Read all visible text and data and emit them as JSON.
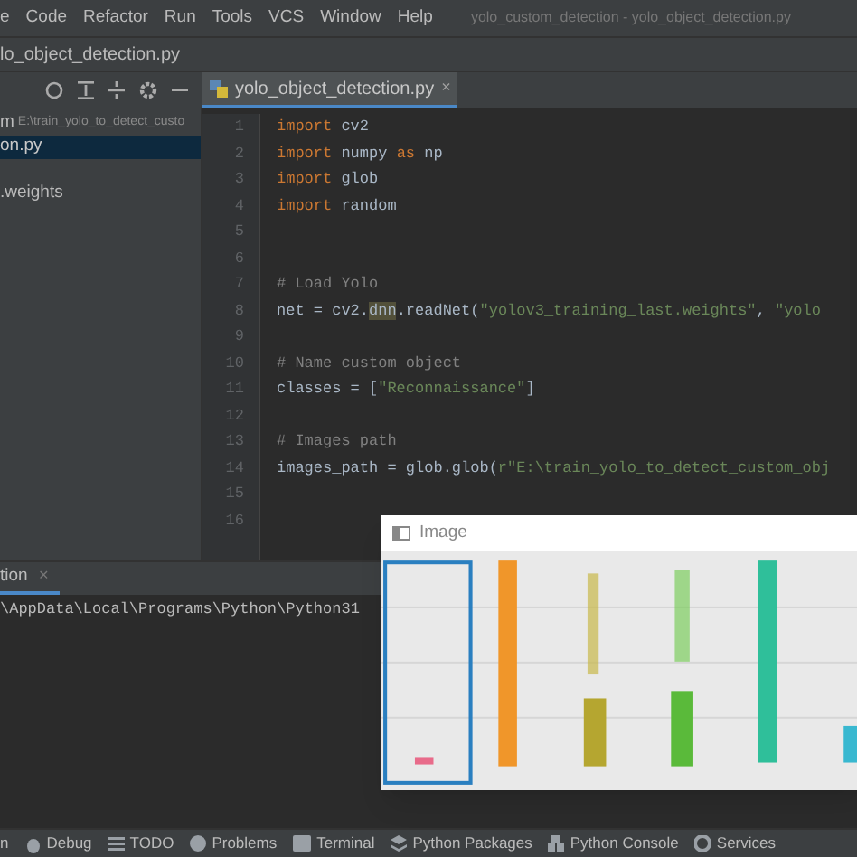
{
  "menu_bar": {
    "items": [
      "e",
      "Code",
      "Refactor",
      "Run",
      "Tools",
      "VCS",
      "Window",
      "Help"
    ],
    "title": "yolo_custom_detection - yolo_object_detection.py"
  },
  "breadcrumb": "lo_object_detection.py",
  "editor_tab": {
    "label": "yolo_object_detection.py",
    "close": "×"
  },
  "project_panel": [
    {
      "label": "m",
      "path": "E:\\train_yolo_to_detect_custo",
      "selected": false
    },
    {
      "label": "on.py",
      "selected": true
    },
    {
      "label": ".weights",
      "selected": false
    }
  ],
  "code_lines": [
    {
      "number": "1",
      "tokens": [
        {
          "kind": "keyword",
          "text": "import"
        },
        {
          "kind": "plain",
          "text": " cv2"
        }
      ]
    },
    {
      "number": "2",
      "tokens": [
        {
          "kind": "keyword",
          "text": "import"
        },
        {
          "kind": "plain",
          "text": " numpy "
        },
        {
          "kind": "keyword",
          "text": "as"
        },
        {
          "kind": "plain",
          "text": " np"
        }
      ]
    },
    {
      "number": "3",
      "tokens": [
        {
          "kind": "keyword",
          "text": "import"
        },
        {
          "kind": "plain",
          "text": " glob"
        }
      ]
    },
    {
      "number": "4",
      "tokens": [
        {
          "kind": "keyword",
          "text": "import"
        },
        {
          "kind": "plain",
          "text": " random"
        }
      ]
    },
    {
      "number": "5"
    },
    {
      "number": "6"
    },
    {
      "number": "7",
      "tokens": [
        {
          "kind": "comment",
          "text": "# Load Yolo"
        }
      ]
    },
    {
      "number": "8",
      "tokens": [
        {
          "kind": "plain",
          "text": "net = cv2."
        },
        {
          "kind": "highlight",
          "text": "dnn"
        },
        {
          "kind": "plain",
          "text": ".readNet("
        },
        {
          "kind": "string",
          "text": "\"yolov3_training_last.weights\""
        },
        {
          "kind": "plain",
          "text": ", "
        },
        {
          "kind": "string",
          "text": "\"yolo"
        }
      ]
    },
    {
      "number": "9"
    },
    {
      "number": "10",
      "tokens": [
        {
          "kind": "comment",
          "text": "# Name custom object"
        }
      ]
    },
    {
      "number": "11",
      "tokens": [
        {
          "kind": "plain",
          "text": "classes = ["
        },
        {
          "kind": "string",
          "text": "\"Reconnaissance\""
        },
        {
          "kind": "plain",
          "text": "]"
        }
      ]
    },
    {
      "number": "12"
    },
    {
      "number": "13",
      "tokens": [
        {
          "kind": "comment",
          "text": "# Images path"
        }
      ]
    },
    {
      "number": "14",
      "tokens": [
        {
          "kind": "plain",
          "text": "images_path = glob.glob("
        },
        {
          "kind": "string",
          "text": "r\"E:\\train_yolo_to_detect_custom_obj"
        }
      ]
    },
    {
      "number": "15"
    },
    {
      "number": "16"
    }
  ],
  "image_window": {
    "title": "Image"
  },
  "run_panel": {
    "tab": "tion",
    "close": "×",
    "output": "\\AppData\\Local\\Programs\\Python\\Python31"
  },
  "tool_bar": [
    "n",
    "Debug",
    "TODO",
    "Problems",
    "Terminal",
    "Python Packages",
    "Python Console",
    "Services"
  ]
}
